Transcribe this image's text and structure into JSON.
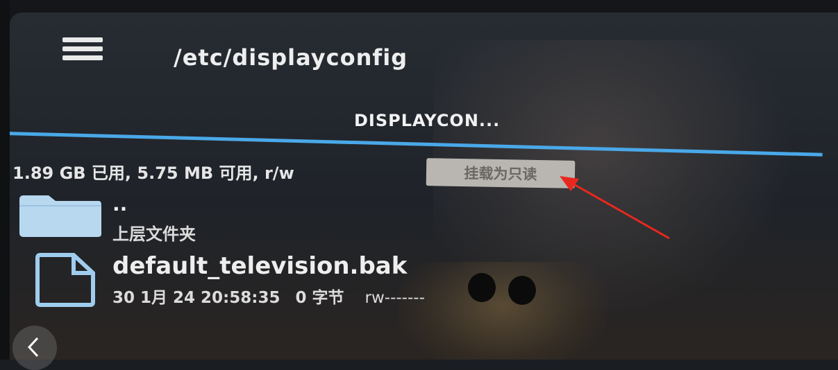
{
  "header": {
    "menu_icon": "hamburger-menu-icon",
    "path_title": "/etc/displayconfig"
  },
  "tabs": [
    {
      "label": "DISPLAYCON..."
    }
  ],
  "storage": {
    "info": "1.89 GB 已用, 5.75 MB 可用, r/w",
    "mount_button_label": "挂载为只读"
  },
  "files": [
    {
      "icon": "folder-icon",
      "name": "..",
      "subtitle": "上层文件夹"
    },
    {
      "icon": "file-icon",
      "name": "default_television.bak",
      "date": "30 1月 24 20:58:35",
      "size": "0 字节",
      "permissions": "rw-------"
    }
  ],
  "nav": {
    "back_icon": "chevron-left-icon"
  },
  "colors": {
    "accent": "#4aa8e8",
    "folder": "#b8d8f0",
    "annotation_arrow": "#e8281e",
    "mount_button_bg": "#b9b6b2"
  }
}
